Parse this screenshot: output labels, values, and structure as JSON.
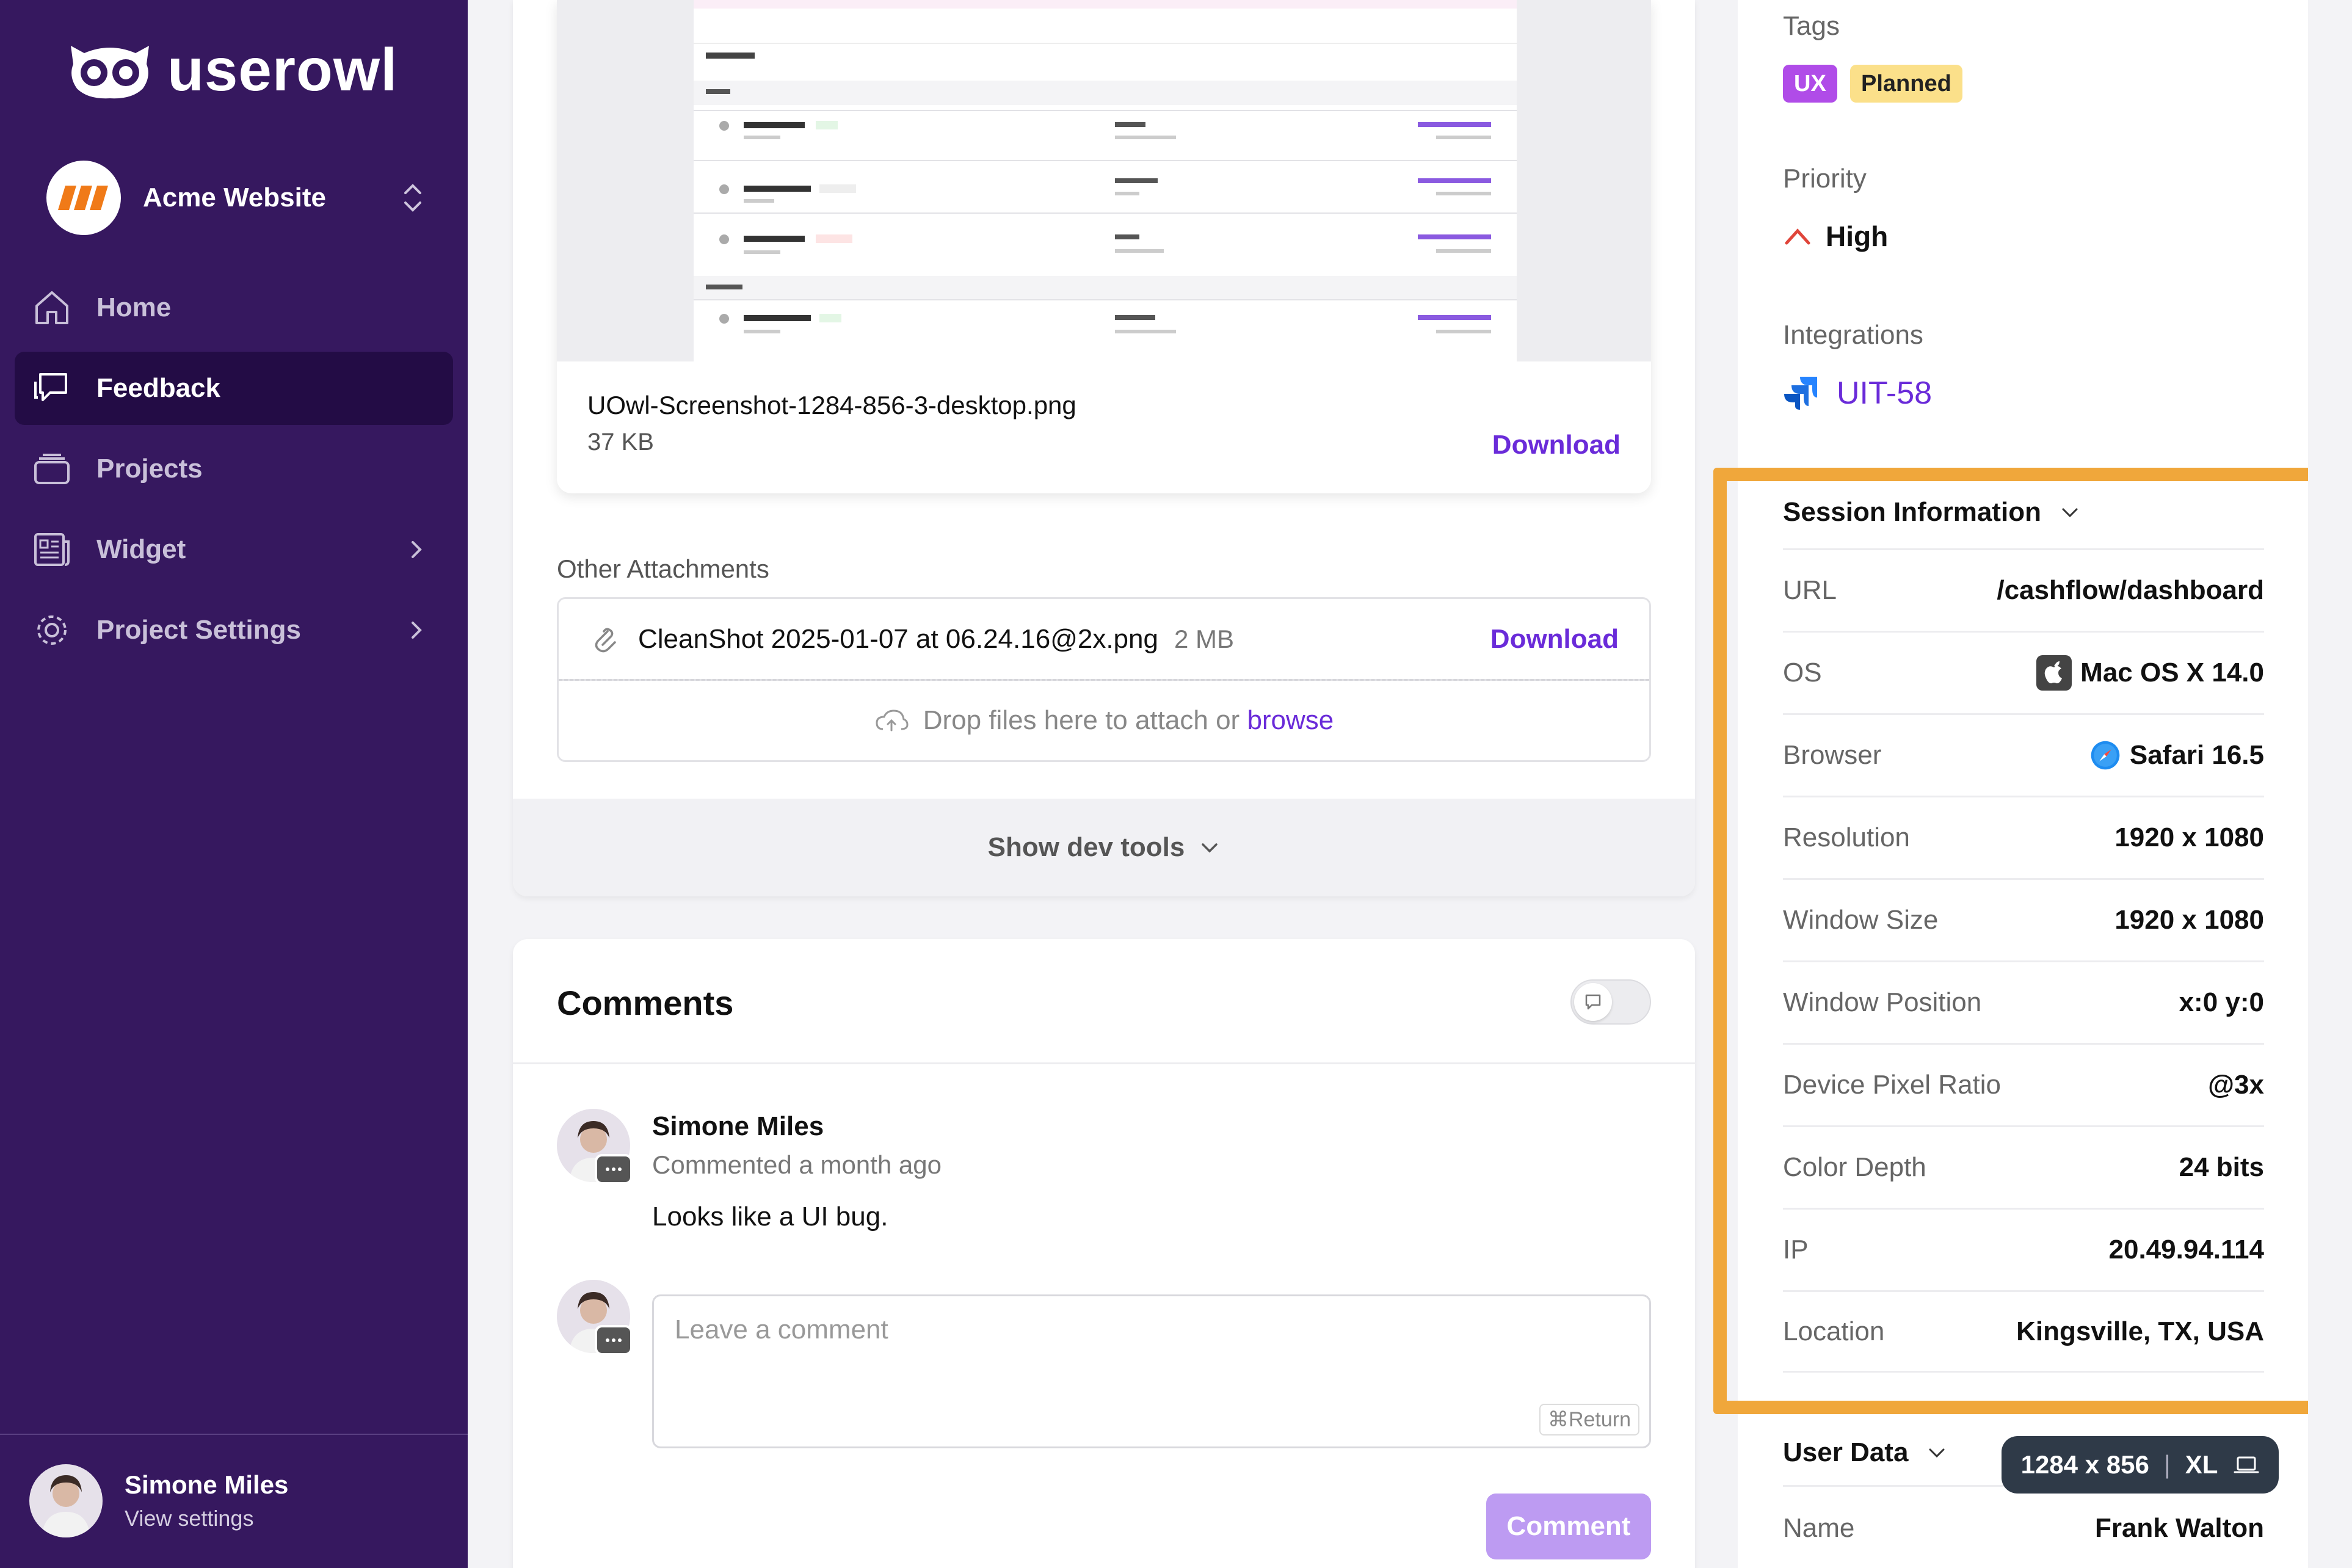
{
  "app": {
    "logo_text": "userowl"
  },
  "sidebar": {
    "project_name": "Acme Website",
    "items": [
      {
        "label": "Home",
        "icon": "home-icon",
        "active": false
      },
      {
        "label": "Feedback",
        "icon": "chat-icon",
        "active": true
      },
      {
        "label": "Projects",
        "icon": "folder-icon",
        "active": false
      },
      {
        "label": "Widget",
        "icon": "newspaper-icon",
        "active": false
      },
      {
        "label": "Project Settings",
        "icon": "gear-icon",
        "active": false
      }
    ],
    "user": {
      "name": "Simone Miles",
      "sub": "View settings"
    }
  },
  "attachments": {
    "screenshot_file": "UOwl-Screenshot-1284-856-3-desktop.png",
    "screenshot_size": "37 KB",
    "download_label": "Download",
    "other_label": "Other Attachments",
    "other_file": "CleanShot 2025-01-07 at 06.24.16@2x.png",
    "other_size": "2 MB",
    "drop_text": "Drop files here to attach or",
    "browse_label": "browse",
    "dev_tools_label": "Show dev tools"
  },
  "comments": {
    "title": "Comments",
    "items": [
      {
        "author": "Simone Miles",
        "meta": "Commented a month ago",
        "body": "Looks like a UI bug."
      }
    ],
    "input_placeholder": "Leave a comment",
    "shortcut": "⌘Return",
    "submit_label": "Comment"
  },
  "details": {
    "tags_label": "Tags",
    "tags": [
      "UX",
      "Planned"
    ],
    "priority_label": "Priority",
    "priority_value": "High",
    "integrations_label": "Integrations",
    "integration_value": "UIT-58"
  },
  "session": {
    "title": "Session Information",
    "rows": [
      {
        "key": "URL",
        "value": "/cashflow/dashboard"
      },
      {
        "key": "OS",
        "value": "Mac OS X 14.0",
        "icon": "apple-icon"
      },
      {
        "key": "Browser",
        "value": "Safari 16.5",
        "icon": "safari-icon"
      },
      {
        "key": "Resolution",
        "value": "1920 x 1080"
      },
      {
        "key": "Window Size",
        "value": "1920 x 1080"
      },
      {
        "key": "Window Position",
        "value": "x:0 y:0"
      },
      {
        "key": "Device Pixel Ratio",
        "value": "@3x"
      },
      {
        "key": "Color Depth",
        "value": "24 bits"
      },
      {
        "key": "IP",
        "value": "20.49.94.114"
      },
      {
        "key": "Location",
        "value": "Kingsville, TX, USA"
      }
    ]
  },
  "user_data": {
    "title": "User Data",
    "name_key": "Name",
    "name_value": "Frank Walton"
  },
  "viewport_pill": {
    "size": "1284 x 856",
    "breakpoint": "XL"
  },
  "colors": {
    "sidebar": "#36185f",
    "accent": "#6a2bd9",
    "highlight": "#f0a73b"
  }
}
